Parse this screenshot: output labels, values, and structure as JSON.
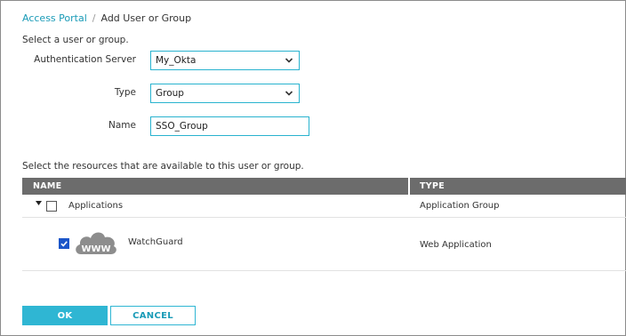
{
  "breadcrumb": {
    "parent": "Access Portal",
    "separator": "/",
    "current": "Add User or Group"
  },
  "intro": "Select a user or group.",
  "form": {
    "auth_server": {
      "label": "Authentication Server",
      "value": "My_Okta"
    },
    "type": {
      "label": "Type",
      "value": "Group"
    },
    "name": {
      "label": "Name",
      "value": "SSO_Group"
    }
  },
  "resources": {
    "title": "Select the resources that are available to this user or group.",
    "columns": [
      "NAME",
      "TYPE"
    ],
    "rows": [
      {
        "name": "Applications",
        "type": "Application Group",
        "checked": false,
        "expanded": true
      },
      {
        "name": "WatchGuard",
        "type": "Web Application",
        "checked": true,
        "icon_text": "WWW"
      }
    ]
  },
  "buttons": {
    "ok": "OK",
    "cancel": "CANCEL"
  },
  "colors": {
    "accent": "#2fb6d3",
    "header": "#6c6c6c",
    "checkbox": "#1b56c9"
  }
}
